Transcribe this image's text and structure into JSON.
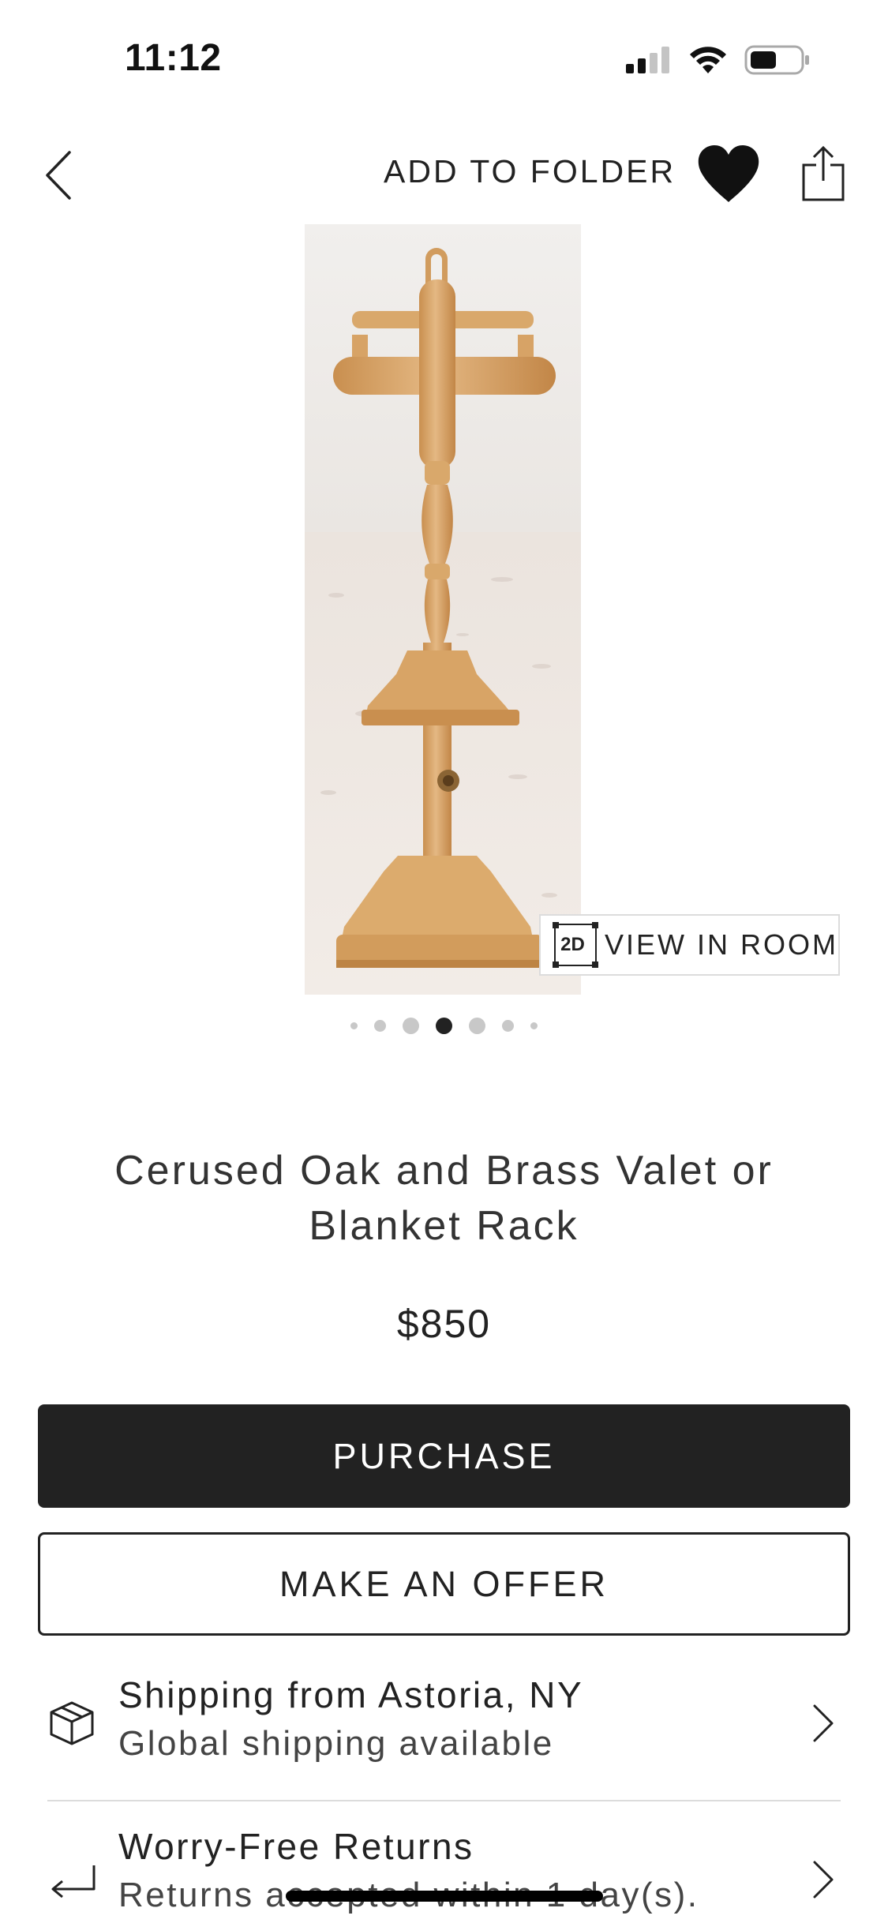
{
  "status_bar": {
    "time": "11:12",
    "signal_icon": "cellular-signal-icon",
    "wifi_icon": "wifi-icon",
    "battery_icon": "battery-icon"
  },
  "nav": {
    "back_icon": "chevron-left-icon",
    "add_to_folder_label": "ADD TO FOLDER",
    "favorite_icon": "heart-icon",
    "share_icon": "share-icon"
  },
  "gallery": {
    "image_description": "wooden valet stand",
    "view_in_room_badge": "2D",
    "view_in_room_label": "VIEW IN ROOM",
    "dot_count": 7,
    "active_index": 3
  },
  "product": {
    "title": "Cerused Oak and Brass Valet or Blanket Rack",
    "price": "$850"
  },
  "actions": {
    "purchase_label": "PURCHASE",
    "offer_label": "MAKE AN OFFER"
  },
  "info": {
    "shipping": {
      "icon": "package-icon",
      "title": "Shipping from Astoria, NY",
      "subtitle": "Global shipping available"
    },
    "returns": {
      "icon": "return-arrow-icon",
      "title": "Worry-Free Returns",
      "subtitle": "Returns accepted within 1 day(s)."
    }
  },
  "colors": {
    "primary_button": "#222222",
    "wood": "#dcae74",
    "background": "#ffffff"
  }
}
